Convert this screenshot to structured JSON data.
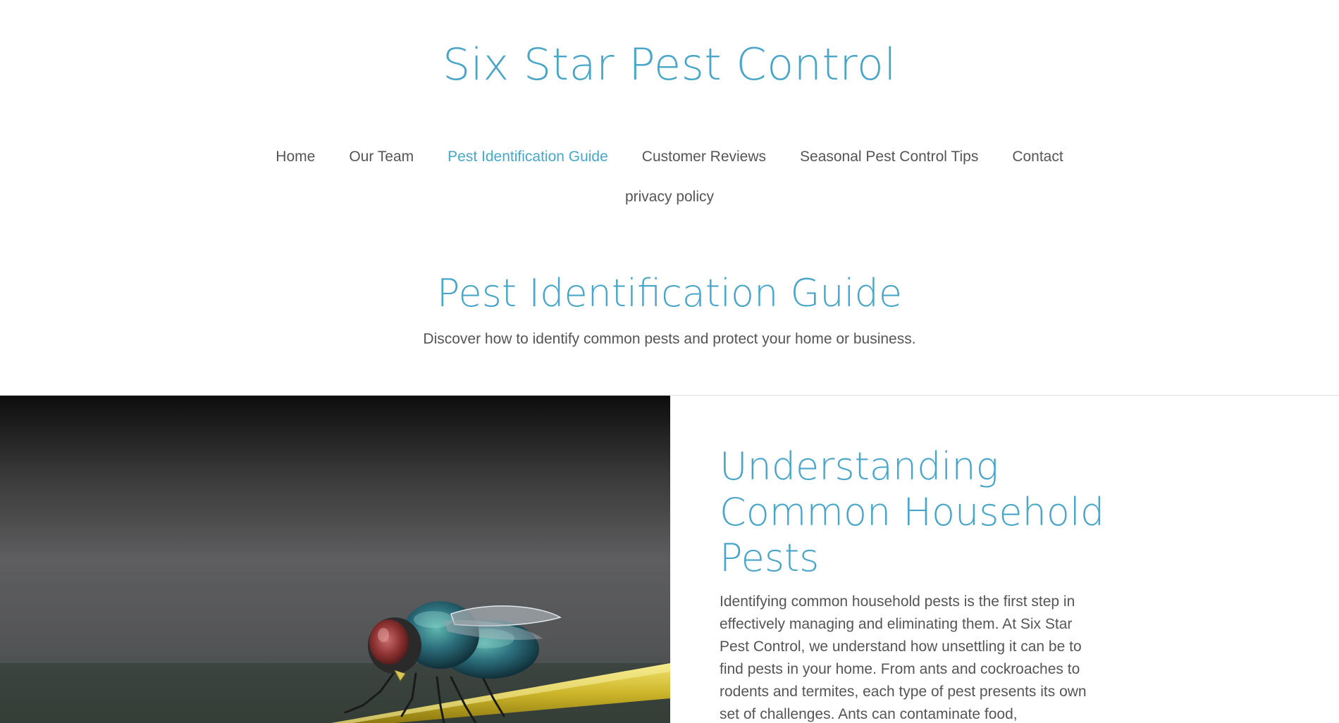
{
  "site": {
    "title": "Six Star Pest Control"
  },
  "nav": {
    "items": [
      {
        "label": "Home"
      },
      {
        "label": "Our Team"
      },
      {
        "label": "Pest Identification Guide",
        "active": true
      },
      {
        "label": "Customer Reviews"
      },
      {
        "label": "Seasonal Pest Control Tips"
      },
      {
        "label": "Contact"
      },
      {
        "label": "privacy policy"
      }
    ]
  },
  "page": {
    "title": "Pest Identification Guide",
    "subtitle": "Discover how to identify common pests and protect your home or business."
  },
  "section": {
    "heading": "Understanding Common Household Pests",
    "body": "Identifying common household pests is the first step in effectively managing and eliminating them. At Six Star Pest Control, we understand how unsettling it can be to find pests in your home. From ants and cockroaches to rodents and termites, each type of pest presents its own set of challenges. Ants can contaminate food,"
  },
  "colors": {
    "accent": "#4aa6c9",
    "text": "#555555",
    "background": "#ffffff"
  },
  "icons": {
    "hero": "fly-photo"
  }
}
